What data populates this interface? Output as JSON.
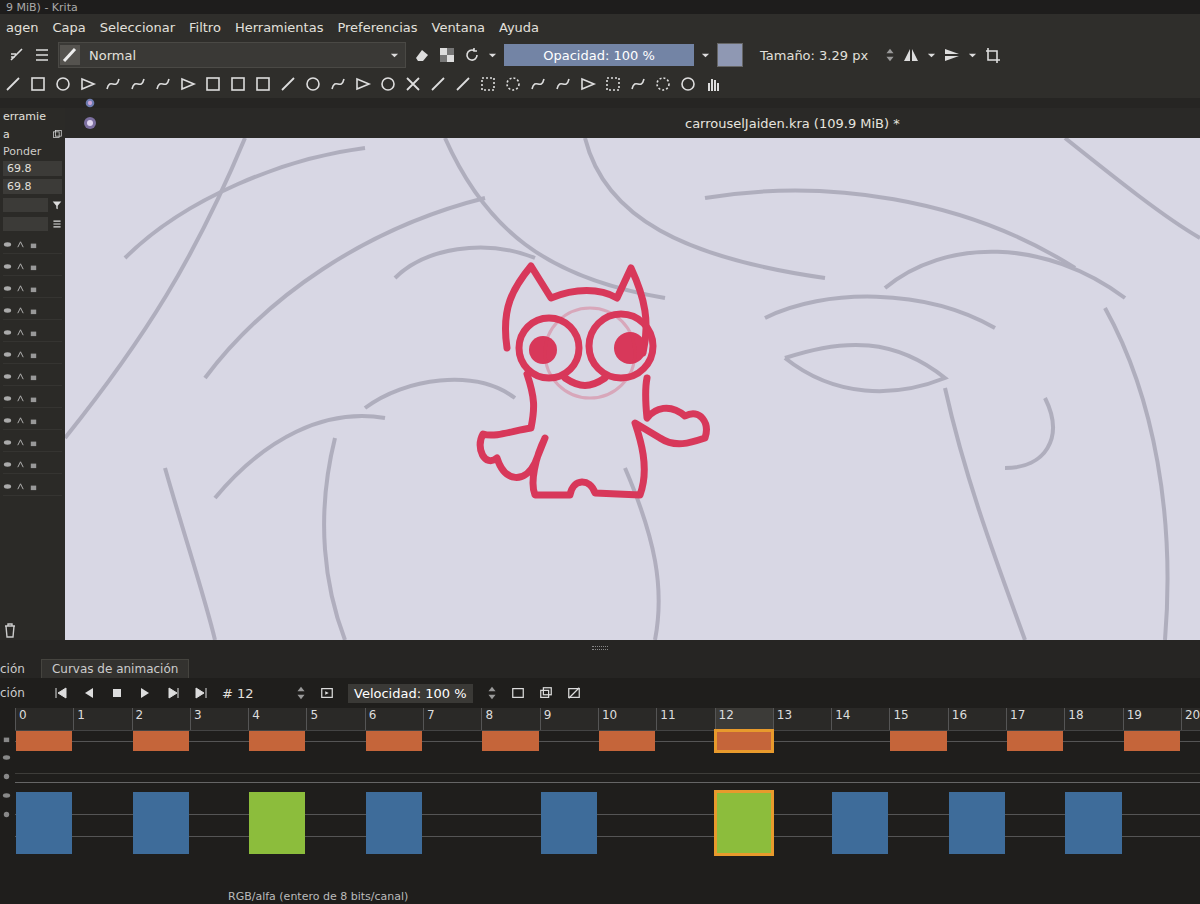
{
  "window": {
    "title": "9 MiB) - Krita"
  },
  "menu": [
    "agen",
    "Capa",
    "Seleccionar",
    "Filtro",
    "Herramientas",
    "Preferencias",
    "Ventana",
    "Ayuda"
  ],
  "tool_options": {
    "blend_mode": "Normal",
    "opacity": {
      "label": "Opacidad: 100 %",
      "level": 1.0
    },
    "color": "#8f98b3",
    "size": "Tamaño: 3.29 px"
  },
  "docker": {
    "title": "erramie",
    "tab": "a",
    "label": "Ponder",
    "values": [
      "69.8",
      "69.8"
    ]
  },
  "document": {
    "tab": "carrouselJaiden.kra (109.9 MiB) *"
  },
  "timeline": {
    "title": "ción",
    "tabs": [
      {
        "label": "ción",
        "selected": true
      },
      {
        "label": "Curvas de animación",
        "selected": false
      }
    ],
    "frame_field": "# 12",
    "speed": "Velocidad: 100 %",
    "ruler": [
      "0",
      "1",
      "2",
      "3",
      "4",
      "5",
      "6",
      "7",
      "8",
      "9",
      "10",
      "11",
      "12",
      "13",
      "14",
      "15",
      "16",
      "17",
      "18",
      "19",
      "20"
    ],
    "current_frame": 12,
    "layers": [
      {
        "keyframes": [
          {
            "frame": 0,
            "color": "#c5653a",
            "selected": false
          },
          {
            "frame": 2,
            "color": "#c5653a",
            "selected": false
          },
          {
            "frame": 4,
            "color": "#c5653a",
            "selected": false
          },
          {
            "frame": 6,
            "color": "#c5653a",
            "selected": false
          },
          {
            "frame": 8,
            "color": "#c5653a",
            "selected": false
          },
          {
            "frame": 10,
            "color": "#c5653a",
            "selected": false
          },
          {
            "frame": 12,
            "color": "#c5653a",
            "selected": true
          },
          {
            "frame": 15,
            "color": "#c5653a",
            "selected": false
          },
          {
            "frame": 17,
            "color": "#c5653a",
            "selected": false
          },
          {
            "frame": 19,
            "color": "#c5653a",
            "selected": false
          }
        ]
      },
      {
        "keyframes": [
          {
            "frame": 0,
            "color": "#3e6c9a",
            "selected": false
          },
          {
            "frame": 2,
            "color": "#3e6c9a",
            "selected": false
          },
          {
            "frame": 4,
            "color": "#8cbd3c",
            "selected": false
          },
          {
            "frame": 6,
            "color": "#3e6c9a",
            "selected": false
          },
          {
            "frame": 9,
            "color": "#3e6c9a",
            "selected": false
          },
          {
            "frame": 12,
            "color": "#8cbd3c",
            "selected": true
          },
          {
            "frame": 14,
            "color": "#3e6c9a",
            "selected": false
          },
          {
            "frame": 16,
            "color": "#3e6c9a",
            "selected": false
          },
          {
            "frame": 18,
            "color": "#3e6c9a",
            "selected": false
          }
        ]
      }
    ]
  },
  "status_bar": "RGB/alfa (entero de 8 bits/canal)"
}
